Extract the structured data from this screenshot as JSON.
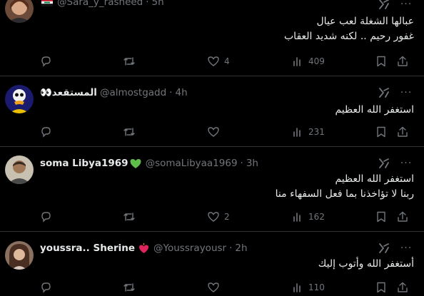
{
  "tweets": [
    {
      "display_name": "",
      "flag": "iraq-flag",
      "handle": "@Sara_y_rasheed",
      "dot": "·",
      "time": "5h",
      "lines": [
        "عبالها الشغلة لعب عيال",
        "غفور رحيم .. لكنه شديد العقاب"
      ],
      "replies": "",
      "retweets": "",
      "likes": "4",
      "views": "409"
    },
    {
      "display_name": "المستقعد👀",
      "handle": "@almostgadd",
      "dot": "·",
      "time": "4h",
      "lines": [
        "استغفر الله العظيم"
      ],
      "replies": "",
      "retweets": "",
      "likes": "",
      "views": "231"
    },
    {
      "display_name": "soma Libya1969",
      "badge": "green-heart",
      "handle": "@somaLibyaa1969",
      "dot": "·",
      "time": "3h",
      "lines": [
        "استغفر الله العظيم",
        "ربنا لا تؤاخذنا بما فعل السفهاء منا"
      ],
      "replies": "",
      "retweets": "",
      "likes": "2",
      "views": "162"
    },
    {
      "display_name": "youssra.. Sherine",
      "badge": "heart-on-fire",
      "handle": "@Youssrayousr",
      "dot": "·",
      "time": "2h",
      "lines": [
        "أستغفر الله وأتوب إليك"
      ],
      "replies": "",
      "retweets": "",
      "likes": "",
      "views": "110"
    }
  ],
  "icons": {
    "reply": "reply-icon",
    "retweet": "retweet-icon",
    "like": "heart-icon",
    "views": "views-icon",
    "bookmark": "bookmark-icon",
    "share": "share-icon",
    "grok": "grok-icon",
    "more": "more-icon"
  },
  "colors": {
    "background": "#000000",
    "text": "#e7e9ea",
    "muted": "#71767b",
    "border": "#2f3336"
  }
}
